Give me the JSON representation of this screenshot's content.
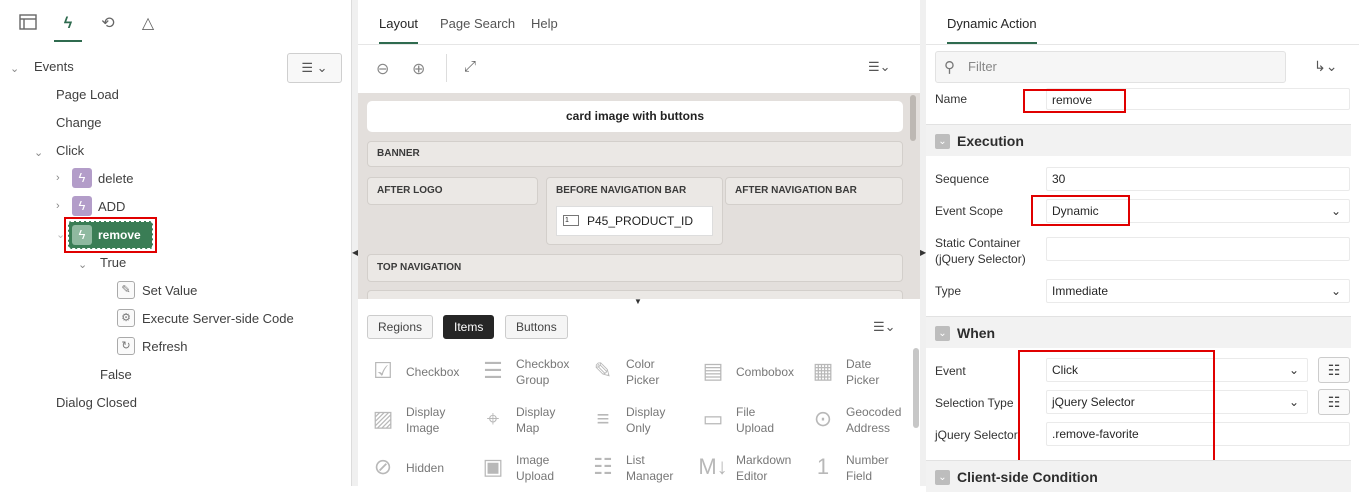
{
  "left": {
    "toolbar_icons": [
      "rendering-icon",
      "dynamic-actions-icon",
      "processing-icon",
      "shared-components-icon"
    ],
    "tree": {
      "root": "Events",
      "page_load": "Page Load",
      "change": "Change",
      "click": "Click",
      "delete": "delete",
      "add": "ADD",
      "remove": "remove",
      "true": "True",
      "set_value": "Set Value",
      "execute_server": "Execute Server-side Code",
      "refresh": "Refresh",
      "false": "False",
      "dialog_closed": "Dialog Closed"
    }
  },
  "mid": {
    "tabs": [
      "Layout",
      "Page Search",
      "Help"
    ],
    "page_title": "card image with buttons",
    "regions": {
      "banner": "BANNER",
      "after_logo": "AFTER LOGO",
      "before_nav": "BEFORE NAVIGATION BAR",
      "after_nav": "AFTER NAVIGATION BAR",
      "item": "P45_PRODUCT_ID",
      "top_nav": "TOP NAVIGATION"
    },
    "gallery_tabs": [
      "Regions",
      "Items",
      "Buttons"
    ],
    "gallery": [
      [
        "Checkbox",
        ""
      ],
      [
        "Checkbox",
        "Group"
      ],
      [
        "Color",
        "Picker"
      ],
      [
        "Combobox",
        ""
      ],
      [
        "Date",
        "Picker"
      ],
      [
        "Display",
        "Image"
      ],
      [
        "Display",
        "Map"
      ],
      [
        "Display",
        "Only"
      ],
      [
        "File",
        "Upload"
      ],
      [
        "Geocoded",
        "Address"
      ],
      [
        "Hidden",
        ""
      ],
      [
        "Image",
        "Upload"
      ],
      [
        "List",
        "Manager"
      ],
      [
        "Markdown",
        "Editor"
      ],
      [
        "Number",
        "Field"
      ]
    ]
  },
  "right": {
    "tab": "Dynamic Action",
    "filter_placeholder": "Filter",
    "name_label": "Name",
    "name_value": "remove",
    "execution": "Execution",
    "sequence_label": "Sequence",
    "sequence_value": "30",
    "event_scope_label": "Event Scope",
    "event_scope_value": "Dynamic",
    "static_label_1": "Static Container",
    "static_label_2": "(jQuery Selector)",
    "static_value": "",
    "type_label": "Type",
    "type_value": "Immediate",
    "when": "When",
    "event_label": "Event",
    "event_value": "Click",
    "selection_type_label": "Selection Type",
    "selection_type_value": "jQuery Selector",
    "jquery_label": "jQuery Selector",
    "jquery_value": ".remove-favorite",
    "client_condition": "Client-side Condition"
  },
  "colors": {
    "accent": "#2f6b4f",
    "highlight_red": "#e00000",
    "da_purple": "#b39dc9",
    "selected_green": "#3a7d55"
  }
}
